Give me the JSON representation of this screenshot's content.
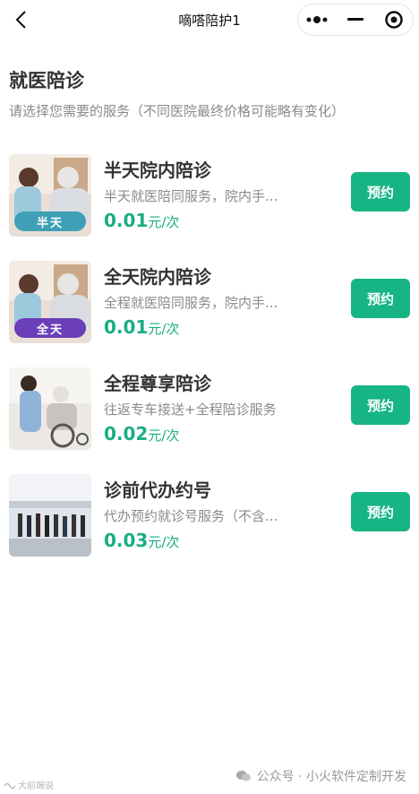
{
  "navbar": {
    "title": "嘀嗒陪护1",
    "back_icon": "chevron-left-icon",
    "capsule": {
      "more_icon": "more-dots-icon",
      "minimize_icon": "minimize-icon",
      "close_icon": "target-close-icon"
    }
  },
  "header": {
    "title": "就医陪诊",
    "subtitle": "请选择您需要的服务（不同医院最终价格可能略有变化）"
  },
  "services": [
    {
      "name": "半天院内陪诊",
      "desc": "半天就医陪同服务，院内手...",
      "price": "0.01",
      "unit": "元/次",
      "badge": "半天",
      "badge_color": "#3e9fb6",
      "button": "预约"
    },
    {
      "name": "全天院内陪诊",
      "desc": "全程就医陪同服务，院内手...",
      "price": "0.01",
      "unit": "元/次",
      "badge": "全天",
      "badge_color": "#6b3fb8",
      "button": "预约"
    },
    {
      "name": "全程尊享陪诊",
      "desc": "往返专车接送+全程陪诊服务",
      "price": "0.02",
      "unit": "元/次",
      "button": "预约"
    },
    {
      "name": "诊前代办约号",
      "desc": "代办预约就诊号服务（不含...",
      "price": "0.03",
      "unit": "元/次",
      "button": "预约"
    }
  ],
  "watermarks": {
    "left": "大前端说",
    "right": "公众号 · 小火软件定制开发"
  },
  "colors": {
    "accent": "#17b585",
    "price": "#1aad84",
    "title": "#333333",
    "muted": "#8a8a8a"
  }
}
